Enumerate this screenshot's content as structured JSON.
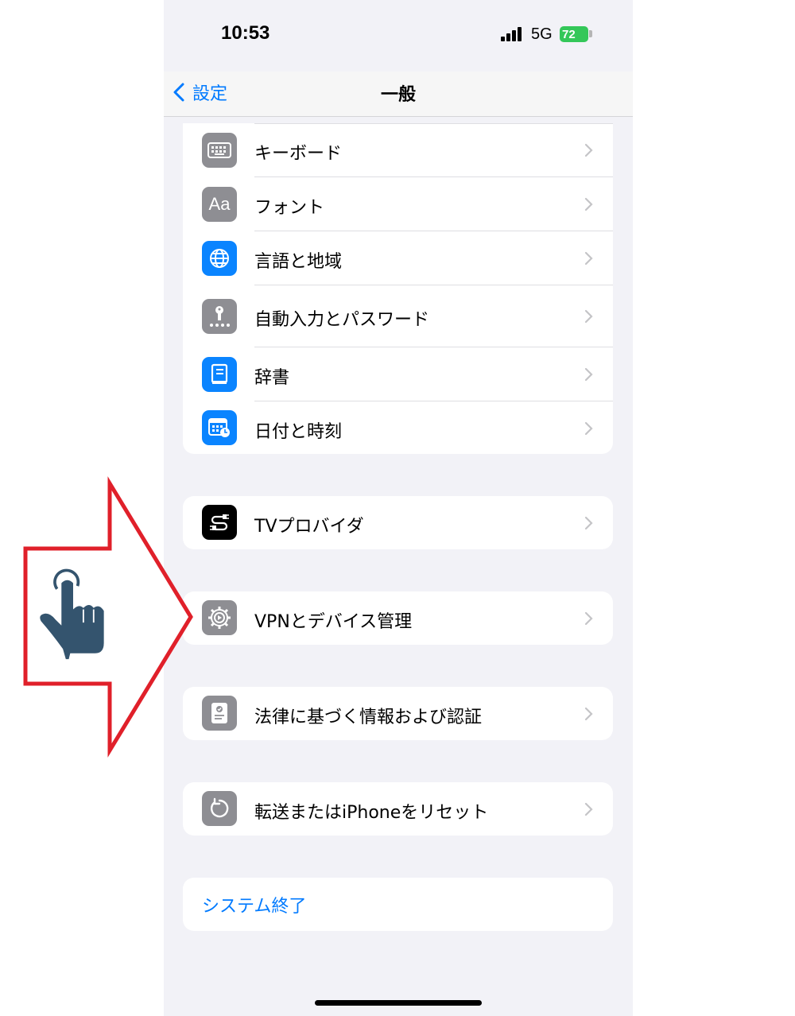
{
  "status_bar": {
    "time": "10:53",
    "network": "5G",
    "battery": "72"
  },
  "nav": {
    "back_label": "設定",
    "title": "一般"
  },
  "groups": [
    {
      "rows": [
        {
          "label": "キーボード",
          "icon": "keyboard-icon"
        },
        {
          "label": "フォント",
          "icon": "font-icon",
          "icon_text": "Aa"
        },
        {
          "label": "言語と地域",
          "icon": "globe-icon"
        },
        {
          "label": "自動入力とパスワード",
          "icon": "key-icon"
        },
        {
          "label": "辞書",
          "icon": "book-icon"
        },
        {
          "label": "日付と時刻",
          "icon": "calendar-clock-icon"
        }
      ]
    },
    {
      "rows": [
        {
          "label": "TVプロバイダ",
          "icon": "tv-provider-icon"
        }
      ]
    },
    {
      "rows": [
        {
          "label": "VPNとデバイス管理",
          "icon": "gear-icon"
        }
      ]
    },
    {
      "rows": [
        {
          "label": "法律に基づく情報および認証",
          "icon": "certificate-icon"
        }
      ]
    },
    {
      "rows": [
        {
          "label": "転送またはiPhoneをリセット",
          "icon": "reset-icon"
        }
      ]
    }
  ],
  "system_off": {
    "label": "システム終了"
  },
  "colors": {
    "accent": "#007aff",
    "annotation_arrow": "#e0202a",
    "hand": "#34546e",
    "battery": "#34c759"
  },
  "annotation": {
    "arrow": "red-outline-arrow-pointing-right",
    "hand": "tap-hand-icon"
  }
}
